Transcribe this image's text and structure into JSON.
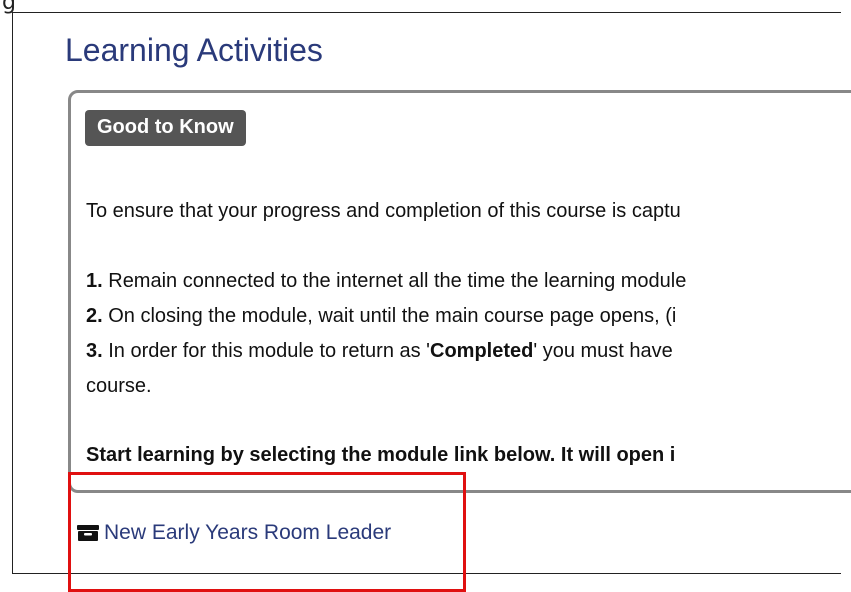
{
  "top_fragment": "g",
  "section": {
    "title": "Learning Activities"
  },
  "card": {
    "badge": "Good to Know",
    "intro": "To ensure that your progress and completion of this course is captu",
    "steps": [
      {
        "num": "1.",
        "text": " Remain connected to the internet all the time the learning module"
      },
      {
        "num": "2.",
        "text": " On closing the module, wait until the main course page opens, (i"
      },
      {
        "num": "3.",
        "text_before": " In order for this module to return as '",
        "bold": "Completed",
        "text_after": "' you must have"
      }
    ],
    "continuation": "course.",
    "cta": "Start learning by selecting the module link below. It will open i"
  },
  "module": {
    "label": "New Early Years Room Leader",
    "icon": "archive-box-icon",
    "color": "#2a3a7a"
  },
  "colors": {
    "title": "#2a3a7a",
    "badge_bg": "#555555",
    "highlight_border": "#e01010"
  }
}
